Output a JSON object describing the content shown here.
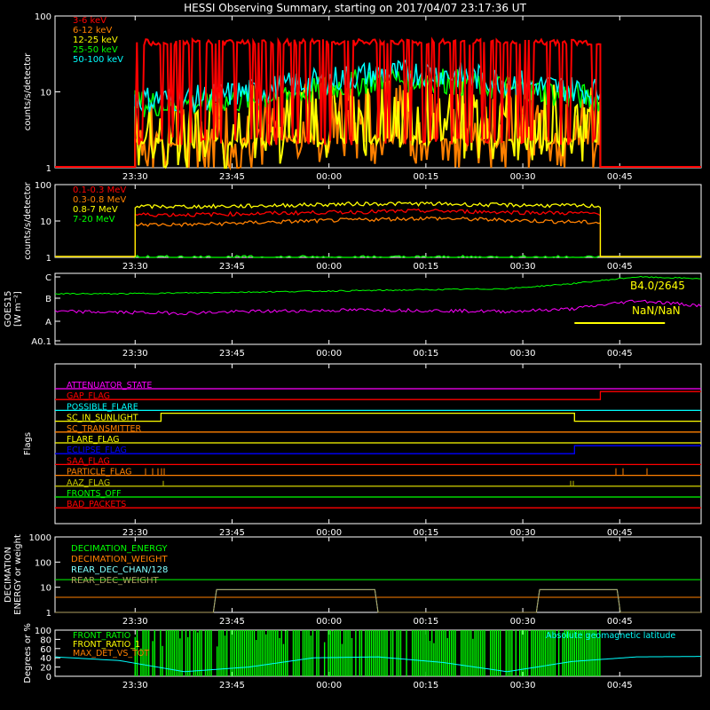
{
  "title": "HESSI Observing Summary, starting on 2017/04/07 23:17:36 UT",
  "time_ticks": [
    "23:30",
    "23:45",
    "00:00",
    "00:15",
    "00:30",
    "00:45"
  ],
  "colors": {
    "background": "#000000",
    "axes": "#ffffff",
    "red": "#ff0000",
    "orange": "#ff8000",
    "yellow": "#ffff00",
    "green": "#00ff00",
    "cyan": "#00ffff",
    "magenta": "#ff00ff",
    "blue": "#0000ff",
    "olive": "#c0c000",
    "lightblue": "#80ffff",
    "tan": "#b0a060"
  },
  "chart_data": [
    {
      "type": "line",
      "id": "lowenergy",
      "ylabel": "counts/s/detector",
      "yscale": "log",
      "ylim": [
        1,
        100
      ],
      "yticks": [
        "1",
        "10",
        "100"
      ],
      "time_range": [
        "23:17:36",
        "00:57:36"
      ],
      "data_interval": [
        "23:30",
        "00:42"
      ],
      "series": [
        {
          "name": "3-6 keV",
          "color": "red",
          "values": [
            45,
            45,
            45,
            45,
            45,
            45,
            45,
            45,
            45
          ]
        },
        {
          "name": "6-12 keV",
          "color": "orange",
          "values": [
            2.5,
            2.5,
            2.8,
            3.2,
            3.5,
            3.5,
            3.2,
            3.0,
            2.8
          ]
        },
        {
          "name": "12-25 keV",
          "color": "yellow",
          "values": [
            3.0,
            3.0,
            3.5,
            4.0,
            5.0,
            5.0,
            4.5,
            4.0,
            3.5
          ]
        },
        {
          "name": "25-50 keV",
          "color": "green",
          "values": [
            7,
            7,
            8,
            10,
            14,
            15,
            12,
            10,
            8
          ]
        },
        {
          "name": "50-100 keV",
          "color": "cyan",
          "values": [
            8,
            8,
            10,
            13,
            17,
            18,
            15,
            12,
            10
          ]
        }
      ]
    },
    {
      "type": "line",
      "id": "highenergy",
      "ylabel": "counts/s/detector",
      "yscale": "log",
      "ylim": [
        1,
        100
      ],
      "yticks": [
        "1",
        "10",
        "100"
      ],
      "data_interval": [
        "23:30",
        "00:42"
      ],
      "series": [
        {
          "name": "0.1-0.3 MeV",
          "color": "red",
          "values": [
            15,
            15,
            16,
            17,
            18,
            19,
            18,
            17,
            16
          ]
        },
        {
          "name": "0.3-0.8 MeV",
          "color": "orange",
          "values": [
            8,
            8,
            9,
            10,
            11,
            12,
            11,
            10,
            9
          ]
        },
        {
          "name": "0.8-7 MeV",
          "color": "yellow",
          "values": [
            25,
            25,
            26,
            28,
            30,
            30,
            28,
            27,
            26
          ]
        },
        {
          "name": "7-20 MeV",
          "color": "green",
          "values": [
            1,
            1,
            1,
            1,
            1,
            1,
            1,
            1,
            1
          ]
        }
      ]
    },
    {
      "type": "line",
      "id": "goes",
      "ylabel": "GOES15",
      "ylabel2": "[W m⁻²]",
      "yticks": [
        "A0.1",
        "A",
        "B",
        "C"
      ],
      "annotations": [
        "B4.0/2645",
        "NaN/NaN"
      ],
      "series": [
        {
          "name": "GOES long",
          "color": "green",
          "values": [
            6.0,
            6.0,
            6.1,
            6.2,
            6.3,
            6.4,
            6.5,
            6.6,
            7.2,
            8.0,
            7.8
          ]
        },
        {
          "name": "GOES short",
          "color": "magenta",
          "values": [
            3.9,
            3.8,
            3.7,
            3.9,
            4.0,
            4.1,
            4.0,
            3.9,
            4.2,
            5.2,
            4.6
          ]
        }
      ]
    },
    {
      "type": "line",
      "id": "flags",
      "ylabel": "Flags",
      "flags": [
        {
          "name": "ATTENUATOR_STATE",
          "color": "magenta",
          "transitions": []
        },
        {
          "name": "GAP_FLAG",
          "color": "red",
          "transitions": [
            [
              "00:42",
              1
            ]
          ]
        },
        {
          "name": "POSSIBLE_FLARE",
          "color": "cyan",
          "transitions": []
        },
        {
          "name": "SC_IN_SUNLIGHT",
          "color": "yellow",
          "transitions": [
            [
              "23:34",
              1
            ],
            [
              "00:38",
              0
            ]
          ]
        },
        {
          "name": "SC_TRANSMITTER",
          "color": "orange",
          "transitions": []
        },
        {
          "name": "FLARE_FLAG",
          "color": "yellow",
          "transitions": []
        },
        {
          "name": "ECLIPSE_FLAG",
          "color": "blue",
          "transitions": [
            [
              "23:34",
              0
            ],
            [
              "00:38",
              1
            ]
          ]
        },
        {
          "name": "SAA_FLAG",
          "color": "red",
          "transitions": []
        },
        {
          "name": "PARTICLE_FLAG",
          "color": "orange",
          "transitions": []
        },
        {
          "name": "AAZ_FLAG",
          "color": "olive",
          "transitions": []
        },
        {
          "name": "FRONTS_OFF",
          "color": "green",
          "transitions": []
        },
        {
          "name": "BAD_PACKETS",
          "color": "red",
          "transitions": []
        }
      ]
    },
    {
      "type": "line",
      "id": "decimation",
      "ylabel": "DECIMATION",
      "ylabel2": "ENERGY or weight",
      "yscale": "log",
      "ylim": [
        1,
        1000
      ],
      "yticks": [
        "1",
        "10",
        "100",
        "1000"
      ],
      "series": [
        {
          "name": "DECIMATION_ENERGY",
          "color": "green",
          "values": [
            20,
            20,
            20,
            20,
            20,
            20,
            20,
            20
          ]
        },
        {
          "name": "DECIMATION_WEIGHT",
          "color": "orange",
          "values": [
            4,
            4,
            4,
            4,
            4,
            4,
            4,
            4
          ]
        },
        {
          "name": "REAR_DEC_CHAN/128",
          "color": "lightblue",
          "values": [
            1,
            1,
            8,
            8,
            1,
            1,
            8,
            1
          ]
        },
        {
          "name": "REAR_DEC_WEIGHT",
          "color": "tan",
          "values": [
            1,
            1,
            8,
            8,
            1,
            1,
            8,
            1
          ]
        }
      ]
    },
    {
      "type": "line",
      "id": "ratios",
      "ylabel": "Degrees or %",
      "ylim": [
        0,
        100
      ],
      "yticks": [
        "0",
        "20",
        "40",
        "60",
        "80",
        "100"
      ],
      "annotation": "Absolute geomagnetic latitude",
      "series": [
        {
          "name": "FRONT_RATIO",
          "color": "green"
        },
        {
          "name": "FRONT_RATIO_1",
          "color": "yellow"
        },
        {
          "name": "MAX_DET_VS_TOT",
          "color": "orange"
        },
        {
          "name": "Absolute geomagnetic latitude",
          "color": "cyan",
          "values": [
            42,
            34,
            10,
            20,
            40,
            42,
            30,
            10,
            32,
            42,
            43
          ]
        }
      ]
    }
  ]
}
